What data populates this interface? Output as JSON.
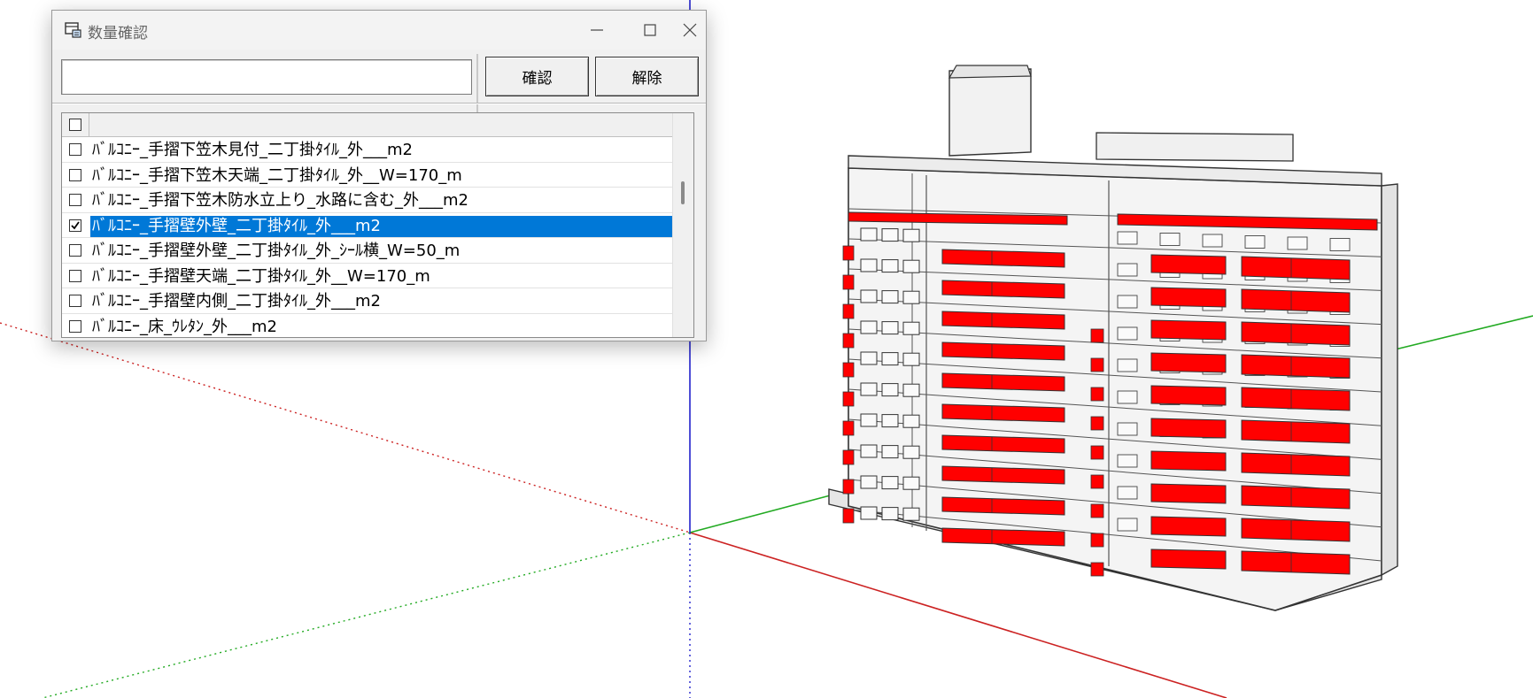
{
  "window": {
    "title": "数量確認",
    "icon": "app-icon"
  },
  "toolbar": {
    "search_value": "",
    "search_placeholder": "",
    "confirm_label": "確認",
    "release_label": "解除"
  },
  "list": {
    "header_checked": false,
    "selected_index": 3,
    "items": [
      {
        "label": "ﾊﾞﾙｺﾆｰ_手摺下笠木見付_二丁掛ﾀｲﾙ_外___m2",
        "checked": false
      },
      {
        "label": "ﾊﾞﾙｺﾆｰ_手摺下笠木天端_二丁掛ﾀｲﾙ_外__W=170_m",
        "checked": false
      },
      {
        "label": "ﾊﾞﾙｺﾆｰ_手摺下笠木防水立上り_水路に含む_外___m2",
        "checked": false
      },
      {
        "label": "ﾊﾞﾙｺﾆｰ_手摺壁外壁_二丁掛ﾀｲﾙ_外___m2",
        "checked": true
      },
      {
        "label": "ﾊﾞﾙｺﾆｰ_手摺壁外壁_二丁掛ﾀｲﾙ_外_ｼｰﾙ横_W=50_m",
        "checked": false
      },
      {
        "label": "ﾊﾞﾙｺﾆｰ_手摺壁天端_二丁掛ﾀｲﾙ_外__W=170_m",
        "checked": false
      },
      {
        "label": "ﾊﾞﾙｺﾆｰ_手摺壁内側_二丁掛ﾀｲﾙ_外___m2",
        "checked": false
      },
      {
        "label": "ﾊﾞﾙｺﾆｰ_床_ｳﾚﾀﾝ_外___m2",
        "checked": false
      }
    ]
  },
  "colors": {
    "selection": "#0078d7",
    "highlight_red": "#ff0000",
    "axis_red": "#cc2222",
    "axis_green": "#22aa22",
    "axis_blue": "#2222cc"
  }
}
